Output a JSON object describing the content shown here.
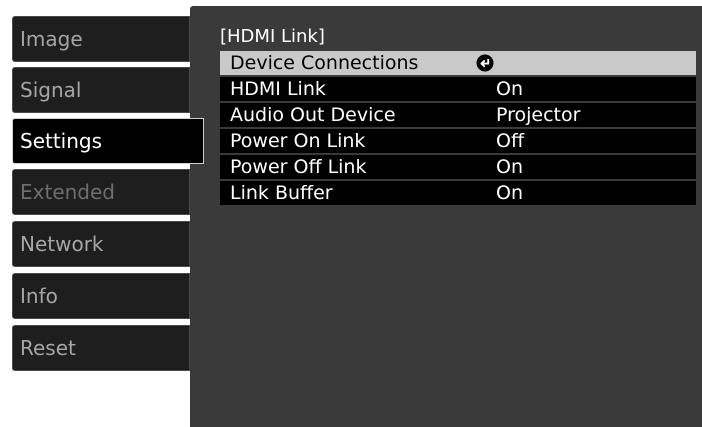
{
  "sidebar": {
    "items": [
      {
        "label": "Image"
      },
      {
        "label": "Signal"
      },
      {
        "label": "Settings"
      },
      {
        "label": "Extended"
      },
      {
        "label": "Network"
      },
      {
        "label": "Info"
      },
      {
        "label": "Reset"
      }
    ],
    "active": "Settings"
  },
  "panel": {
    "title": "[HDMI Link]",
    "rows": [
      {
        "label": "Device Connections",
        "value": "",
        "icon": "enter-icon"
      },
      {
        "label": "HDMI Link",
        "value": "On"
      },
      {
        "label": "Audio Out Device",
        "value": "Projector"
      },
      {
        "label": "Power On Link",
        "value": "Off"
      },
      {
        "label": "Power Off Link",
        "value": "On"
      },
      {
        "label": "Link Buffer",
        "value": "On"
      }
    ]
  },
  "colors": {
    "panel_background": "#3a3a3a",
    "row_background": "#000000",
    "selected_row": "#c9c9c9",
    "tab_background": "#1e1e1e"
  }
}
